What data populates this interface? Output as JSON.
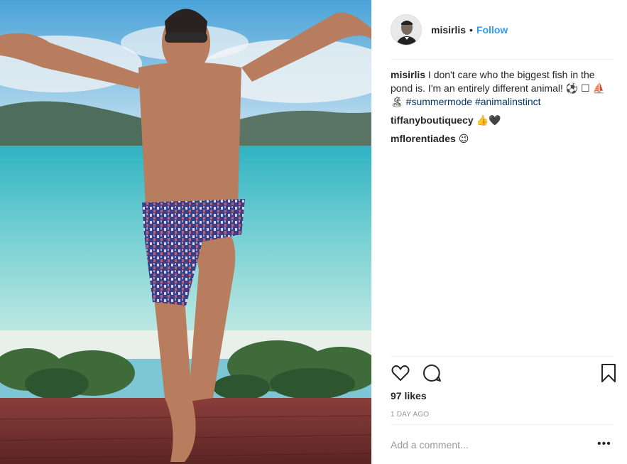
{
  "post": {
    "image_alt": "Man in swim shorts posing on a deck by the sea",
    "author": "misirlis",
    "separator": "•",
    "follow_label": "Follow"
  },
  "comments": [
    {
      "user": "misirlis",
      "text": " I don't care who the biggest fish in the pond is. I'm an entirely different animal! ⚽ ☐ ⛵ 🏝 ",
      "hashtags": [
        "#summermode",
        "#animalinstinct"
      ]
    },
    {
      "user": "tiffanyboutiquecy",
      "text": " 👍🖤"
    },
    {
      "user": "mflorentiades",
      "text": " 😉"
    }
  ],
  "actions": {
    "like_icon": "heart-icon",
    "comment_icon": "comment-bubble-icon",
    "save_icon": "bookmark-icon"
  },
  "likes_label": "97 likes",
  "timestamp": "1 DAY AGO",
  "add_comment": {
    "placeholder": "Add a comment..."
  },
  "more_label": "•••",
  "colors": {
    "link": "#3897f0",
    "hashtag": "#003569",
    "muted": "#999999",
    "divider": "#efefef"
  }
}
